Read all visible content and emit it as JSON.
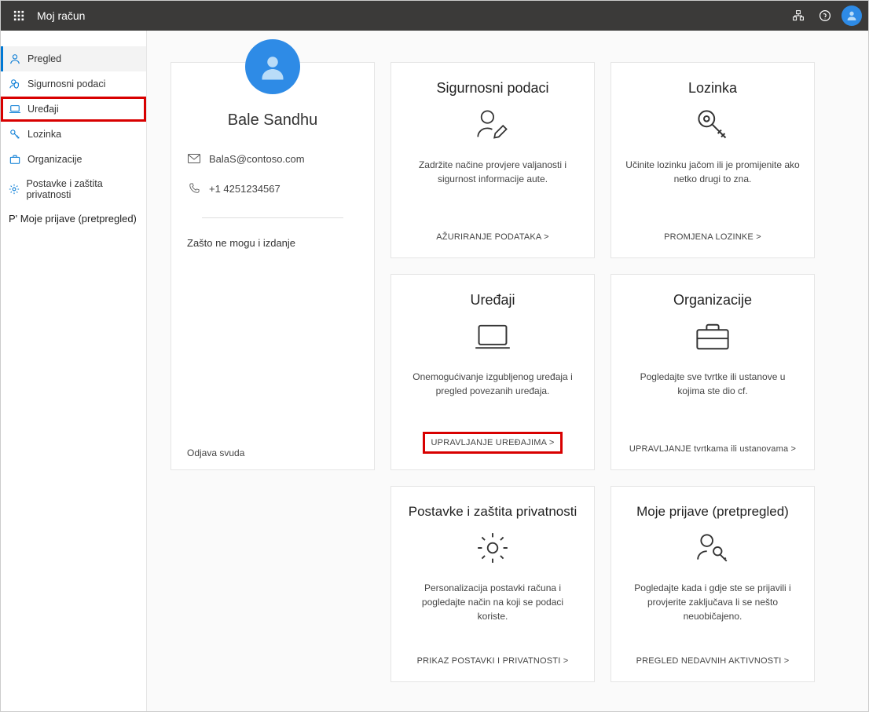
{
  "topbar": {
    "title": "Moj račun"
  },
  "sidebar": {
    "items": [
      {
        "label": "Pregled",
        "icon": "person"
      },
      {
        "label": "Sigurnosni podaci",
        "icon": "shield"
      },
      {
        "label": "Uređaji",
        "icon": "laptop"
      },
      {
        "label": "Lozinka",
        "icon": "key"
      },
      {
        "label": "Organizacije",
        "icon": "briefcase"
      },
      {
        "label": "Postavke i zaštita privatnosti",
        "icon": "gear"
      },
      {
        "label": "P' Moje prijave (pretpregled)",
        "icon": ""
      }
    ]
  },
  "profile": {
    "name": "Bale  Sandhu",
    "email": "BalaS@contoso.com",
    "phone": "+1 4251234567",
    "why_link": "Zašto ne mogu i izdanje",
    "signout": "Odjava svuda"
  },
  "cards": {
    "security": {
      "title": "Sigurnosni podaci",
      "desc": "Zadržite načine provjere valjanosti i sigurnost informacije aute.",
      "action": "AŽURIRANJE PODATAKA &gt;"
    },
    "password": {
      "title": "Lozinka",
      "desc": "Učinite lozinku jačom ili je promijenite ako netko drugi to zna.",
      "action": "PROMJENA LOZINKE &gt;"
    },
    "devices": {
      "title": "Uređaji",
      "desc": "Onemogućivanje izgubljenog uređaja i pregled povezanih uređaja.",
      "action": "UPRAVLJANJE UREĐAJIMA &gt;"
    },
    "orgs": {
      "title": "Organizacije",
      "desc": "Pogledajte sve tvrtke ili ustanove u kojima ste dio cf.",
      "action": "UPRAVLJANJE tvrtkama ili ustanovama &gt;"
    },
    "settings": {
      "title": "Postavke i zaštita privatnosti",
      "desc": "Personalizacija postavki računa i pogledajte način na koji se podaci koriste.",
      "action": "PRIKAZ POSTAVKI I PRIVATNOSTI &gt;"
    },
    "signins": {
      "title": "Moje prijave (pretpregled)",
      "desc": "Pogledajte kada i gdje ste se prijavili i provjerite zaključava li se nešto neuobičajeno.",
      "action": "PREGLED NEDAVNIH AKTIVNOSTI &gt;"
    }
  }
}
